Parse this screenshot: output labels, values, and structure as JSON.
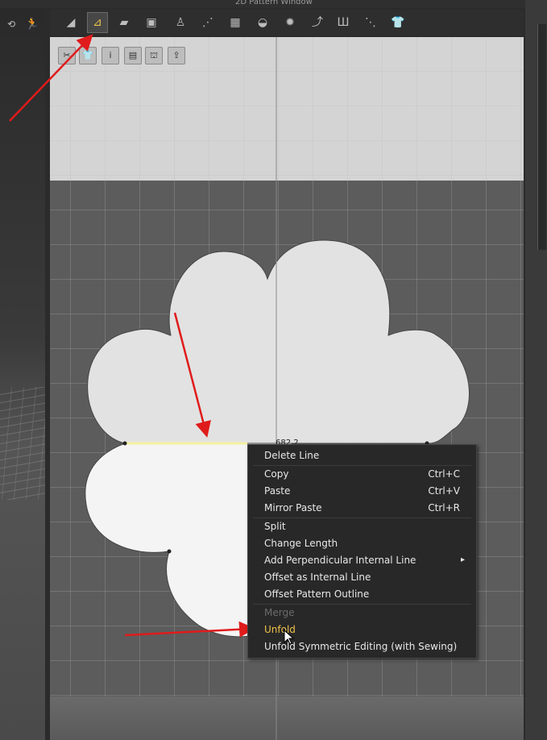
{
  "window": {
    "title": "2D Pattern Window"
  },
  "measurement": {
    "value": "682.2"
  },
  "context_menu": {
    "items": [
      {
        "label": "Delete Line",
        "shortcut": ""
      },
      {
        "label": "Copy",
        "shortcut": "Ctrl+C"
      },
      {
        "label": "Paste",
        "shortcut": "Ctrl+V"
      },
      {
        "label": "Mirror Paste",
        "shortcut": "Ctrl+R"
      },
      {
        "label": "Split",
        "shortcut": ""
      },
      {
        "label": "Change Length",
        "shortcut": ""
      },
      {
        "label": "Add Perpendicular Internal Line",
        "shortcut": ""
      },
      {
        "label": "Offset as Internal Line",
        "shortcut": ""
      },
      {
        "label": "Offset Pattern Outline",
        "shortcut": ""
      },
      {
        "label": "Merge",
        "shortcut": ""
      },
      {
        "label": "Unfold",
        "shortcut": ""
      },
      {
        "label": "Unfold Symmetric Editing (with Sewing)",
        "shortcut": ""
      }
    ],
    "submenu_glyph": "▸"
  },
  "colors": {
    "accent_highlight": "#f0c24a",
    "annotation_arrow": "#e01b1b",
    "selected_line": "#f5f0a0",
    "disabled_text": "#6b6b6b",
    "pattern_fill": "#e2e2e2",
    "pattern_selected_fill": "#f4f4f4"
  },
  "icons": {
    "toolbar": [
      "transform-pattern-icon",
      "edit-pattern-icon",
      "polygon-icon",
      "rectangle-icon",
      "internal-polygon-icon",
      "trace-icon",
      "segment-sewing-icon",
      "free-sewing-icon",
      "pins-icon",
      "fold-arrangement-icon",
      "steam-icon",
      "puckering-icon",
      "tack-icon",
      "measure-icon",
      "avatar-shirt-icon"
    ],
    "mini_toolbar": [
      "scissors-icon",
      "shirt-icon",
      "info-icon",
      "layers-icon",
      "garment-icon",
      "export-icon"
    ]
  }
}
